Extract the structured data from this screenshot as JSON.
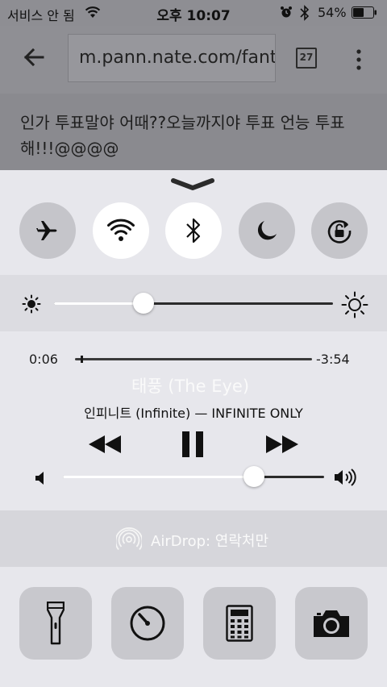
{
  "status_bar": {
    "carrier": "서비스 안 됨",
    "time": "오후 10:07",
    "battery_percent": "54%",
    "battery_level": 0.54,
    "icons": [
      "wifi-icon",
      "alarm-icon",
      "bluetooth-icon",
      "battery-icon"
    ]
  },
  "browser": {
    "url": "m.pann.nate.com/fantalk",
    "tab_count": "27",
    "page_text": "인가 투표말야 어때??오늘까지야 투표 언능 투표해!!!@@@@",
    "icons": [
      "back-arrow-icon",
      "more-vertical-icon"
    ]
  },
  "control_center": {
    "toggles": [
      {
        "name": "airplane-mode",
        "icon": "airplane-icon",
        "on": false
      },
      {
        "name": "wifi",
        "icon": "wifi-icon",
        "on": true
      },
      {
        "name": "bluetooth",
        "icon": "bluetooth-icon",
        "on": true
      },
      {
        "name": "do-not-disturb",
        "icon": "moon-icon",
        "on": false
      },
      {
        "name": "rotation-lock",
        "icon": "rotation-lock-icon",
        "on": false
      }
    ],
    "brightness": {
      "level": 0.32
    },
    "media": {
      "elapsed": "0:06",
      "remaining": "-3:54",
      "progress": 0.025,
      "title": "태풍 (The Eye)",
      "artist_album": "인피니트 (Infinite) — INFINITE ONLY",
      "volume": 0.73
    },
    "airdrop": {
      "label": "AirDrop: 연락처만"
    },
    "shortcuts": [
      {
        "name": "flashlight",
        "icon": "flashlight-icon"
      },
      {
        "name": "timer",
        "icon": "timer-icon"
      },
      {
        "name": "calculator",
        "icon": "calculator-icon"
      },
      {
        "name": "camera",
        "icon": "camera-icon"
      }
    ],
    "colors": {
      "panel": "#e7e7ec",
      "toggle_off": "#c5c5ca",
      "toggle_on": "#ffffff",
      "slider_track": "#2b2b2b"
    }
  }
}
